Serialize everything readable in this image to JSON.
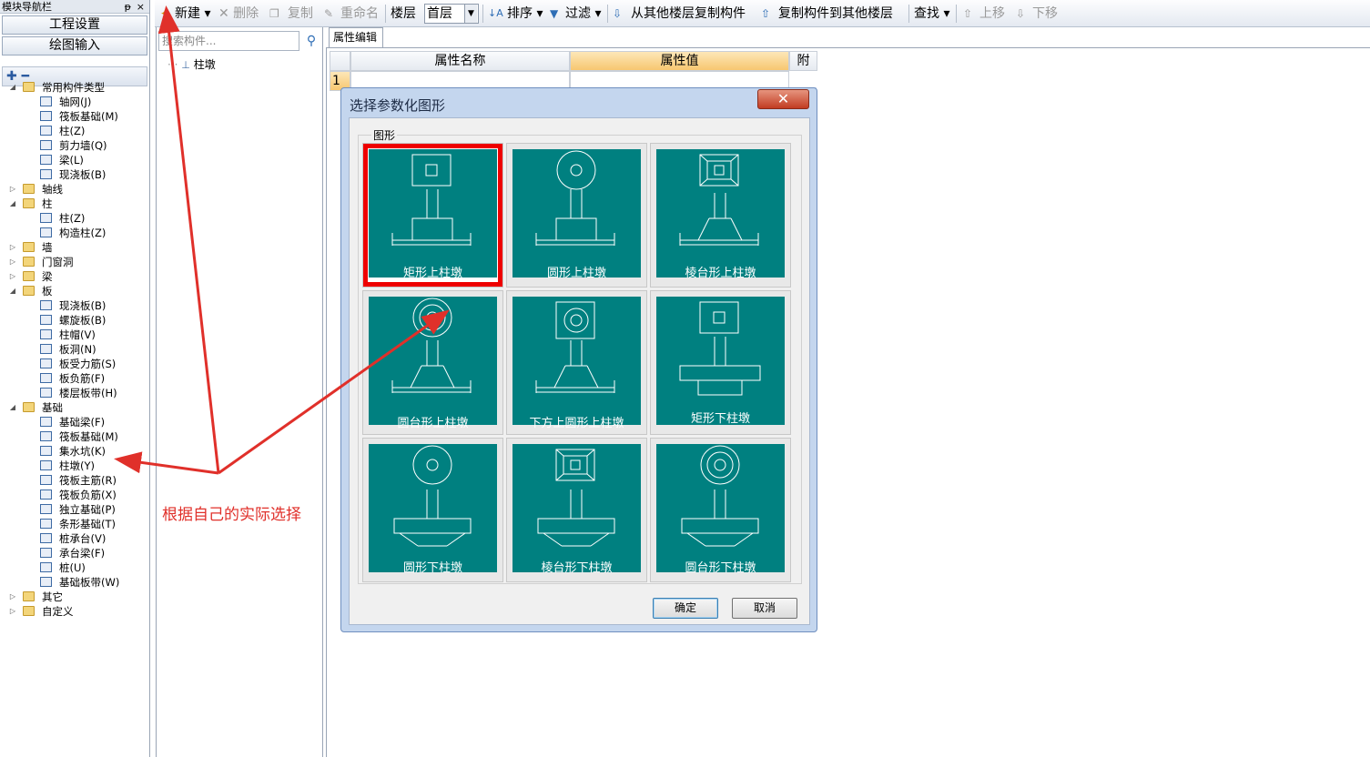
{
  "nav": {
    "title": "模块导航栏",
    "pin": "ᵽ",
    "close": "×",
    "btn1": "工程设置",
    "btn2": "绘图输入",
    "tools": "✚ ━",
    "tree": [
      {
        "label": "常用构件类型",
        "lvl": 0,
        "fold": true,
        "ex": "◢"
      },
      {
        "label": "轴网(J)",
        "lvl": 1
      },
      {
        "label": "筏板基础(M)",
        "lvl": 1
      },
      {
        "label": "柱(Z)",
        "lvl": 1
      },
      {
        "label": "剪力墙(Q)",
        "lvl": 1
      },
      {
        "label": "梁(L)",
        "lvl": 1
      },
      {
        "label": "现浇板(B)",
        "lvl": 1
      },
      {
        "label": "轴线",
        "lvl": 0,
        "fold": true,
        "ex": "▷"
      },
      {
        "label": "柱",
        "lvl": 0,
        "fold": true,
        "ex": "◢"
      },
      {
        "label": "柱(Z)",
        "lvl": 1
      },
      {
        "label": "构造柱(Z)",
        "lvl": 1
      },
      {
        "label": "墙",
        "lvl": 0,
        "fold": true,
        "ex": "▷"
      },
      {
        "label": "门窗洞",
        "lvl": 0,
        "fold": true,
        "ex": "▷"
      },
      {
        "label": "梁",
        "lvl": 0,
        "fold": true,
        "ex": "▷"
      },
      {
        "label": "板",
        "lvl": 0,
        "fold": true,
        "ex": "◢"
      },
      {
        "label": "现浇板(B)",
        "lvl": 1
      },
      {
        "label": "螺旋板(B)",
        "lvl": 1
      },
      {
        "label": "柱帽(V)",
        "lvl": 1
      },
      {
        "label": "板洞(N)",
        "lvl": 1
      },
      {
        "label": "板受力筋(S)",
        "lvl": 1
      },
      {
        "label": "板负筋(F)",
        "lvl": 1
      },
      {
        "label": "楼层板带(H)",
        "lvl": 1
      },
      {
        "label": "基础",
        "lvl": 0,
        "fold": true,
        "ex": "◢"
      },
      {
        "label": "基础梁(F)",
        "lvl": 1
      },
      {
        "label": "筏板基础(M)",
        "lvl": 1
      },
      {
        "label": "集水坑(K)",
        "lvl": 1
      },
      {
        "label": "柱墩(Y)",
        "lvl": 1
      },
      {
        "label": "筏板主筋(R)",
        "lvl": 1
      },
      {
        "label": "筏板负筋(X)",
        "lvl": 1
      },
      {
        "label": "独立基础(P)",
        "lvl": 1
      },
      {
        "label": "条形基础(T)",
        "lvl": 1
      },
      {
        "label": "桩承台(V)",
        "lvl": 1
      },
      {
        "label": "承台梁(F)",
        "lvl": 1
      },
      {
        "label": "桩(U)",
        "lvl": 1
      },
      {
        "label": "基础板带(W)",
        "lvl": 1
      },
      {
        "label": "其它",
        "lvl": 0,
        "fold": true,
        "ex": "▷"
      },
      {
        "label": "自定义",
        "lvl": 0,
        "fold": true,
        "ex": "▷"
      }
    ]
  },
  "toolbar": {
    "new": "新建 ▾",
    "delete": "✕ 删除",
    "copy": "复制",
    "rename": "重命名",
    "floor_label": "楼层",
    "floor_value": "首层",
    "floor_arrow": "▼",
    "sort": "排序 ▾",
    "filter": "过滤 ▾",
    "copy_from": "从其他楼层复制构件",
    "copy_to": "复制构件到其他楼层",
    "find": "查找 ▾",
    "up": "上移",
    "down": "下移"
  },
  "component_list": {
    "search_placeholder": "搜索构件...",
    "search_icon": "⚲",
    "item": "柱墩"
  },
  "props": {
    "tab": "属性编辑",
    "col_name": "属性名称",
    "col_value": "属性值",
    "col_extra": "附",
    "row1": "1"
  },
  "dialog": {
    "title": "选择参数化图形",
    "close": "✕",
    "group": "图形",
    "shapes": [
      {
        "label": "矩形上柱墩",
        "selected": true
      },
      {
        "label": "圆形上柱墩"
      },
      {
        "label": "棱台形上柱墩"
      },
      {
        "label": "圆台形上柱墩"
      },
      {
        "label": "下方上圆形上柱墩"
      },
      {
        "label": "矩形下柱墩"
      },
      {
        "label": "圆形下柱墩"
      },
      {
        "label": "棱台形下柱墩"
      },
      {
        "label": "圆台形下柱墩"
      }
    ],
    "ok": "确定",
    "cancel": "取消"
  },
  "annotation": "根据自己的实际选择",
  "colors": {
    "tile": "#008080",
    "highlight": "#ee0000",
    "arrow": "#e0302a"
  }
}
